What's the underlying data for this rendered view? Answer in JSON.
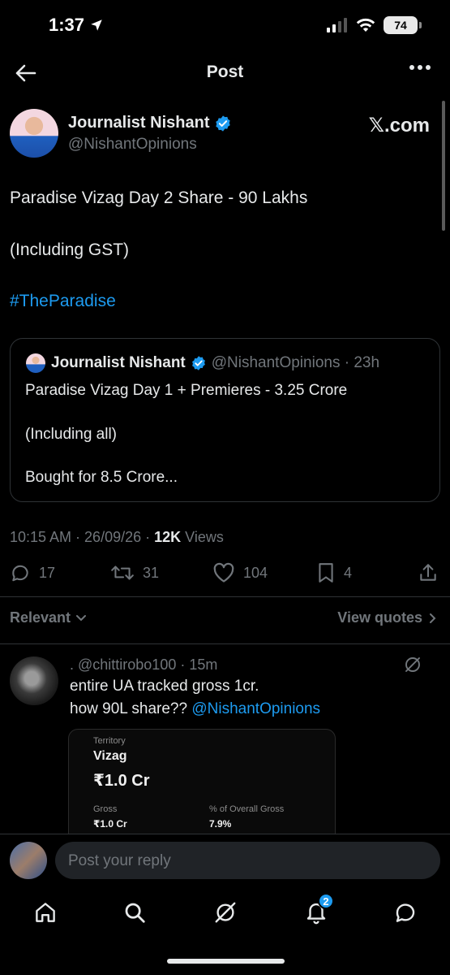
{
  "status_bar": {
    "time": "1:37",
    "battery": "74"
  },
  "header": {
    "title": "Post"
  },
  "author": {
    "name": "Journalist Nishant",
    "handle": "@NishantOpinions",
    "watermark": "𝕏.com"
  },
  "post": {
    "line1": "Paradise Vizag Day 2 Share - 90 Lakhs",
    "line2": "(Including GST)",
    "hashtag": "#TheParadise"
  },
  "quoted": {
    "name": "Journalist Nishant",
    "meta": "@NishantOpinions · 23h",
    "line1": "Paradise Vizag Day 1 + Premieres - 3.25 Crore",
    "line2": "(Including all)",
    "line3": "Bought for 8.5 Crore..."
  },
  "meta": {
    "datetime": "10:15 AM · 26/09/26 · ",
    "views_count": "12K",
    "views_label": " Views"
  },
  "actions": {
    "replies": "17",
    "reposts": "31",
    "likes": "104",
    "bookmarks": "4"
  },
  "sort": {
    "relevant": "Relevant",
    "view_quotes": "View quotes"
  },
  "reply": {
    "header": ". @chittirobo100 · 15m",
    "line1": "entire UA tracked gross 1cr.",
    "line2_prefix": "how 90L share?? ",
    "mention": "@NishantOpinions",
    "embed": {
      "territory_label": "Territory",
      "territory": "Vizag",
      "amount": "₹1.0 Cr",
      "gross_label": "Gross",
      "gross_value": "₹1.0 Cr",
      "pct_label": "% of Overall Gross",
      "pct_value": "7.9%"
    }
  },
  "composer": {
    "placeholder": "Post your reply"
  },
  "nav": {
    "notifications_badge": "2"
  },
  "colors": {
    "accent": "#1d9bf0",
    "background": "#000000",
    "muted": "#71767b",
    "text": "#e7e9ea"
  }
}
